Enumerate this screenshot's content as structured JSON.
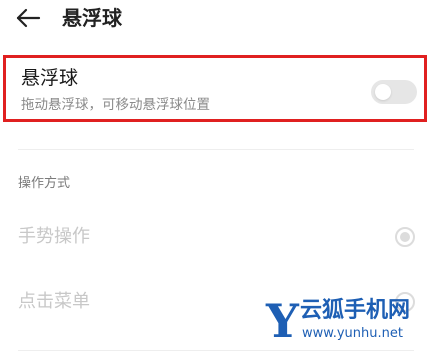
{
  "header": {
    "back_icon": "back-arrow-icon",
    "title": "悬浮球"
  },
  "floating_ball": {
    "title": "悬浮球",
    "subtitle": "拖动悬浮球，可移动悬浮球位置",
    "toggle_on": false
  },
  "operation": {
    "section_label": "操作方式",
    "options": [
      {
        "label": "手势操作",
        "selected": true
      },
      {
        "label": "点击菜单",
        "selected": false
      }
    ]
  },
  "watermark": {
    "logo": "Y",
    "title": "云狐手机网",
    "url": "www.yunhu.net"
  },
  "colors": {
    "highlight_border": "#e02020",
    "watermark_blue": "#1e5fb4",
    "disabled_text": "#c8c8c8"
  }
}
